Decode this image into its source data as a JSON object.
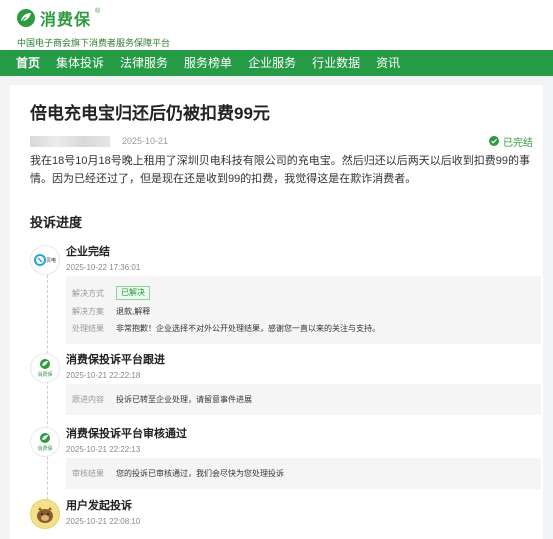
{
  "header": {
    "logo_text": "消费保",
    "logo_reg": "®",
    "tagline": "中国电子商会旗下消费者服务保障平台"
  },
  "nav": {
    "items": [
      "首页",
      "集体投诉",
      "法律服务",
      "服务榜单",
      "企业服务",
      "行业数据",
      "资讯"
    ]
  },
  "complaint": {
    "title": "倍电充电宝归还后仍被扣费99元",
    "date": "2025-10-21",
    "status": "已完结",
    "description": "我在18号10月18号晚上租用了深圳贝电科技有限公司的充电宝。然后归还以后两天以后收到扣费99的事情。因为已经还过了，但是现在还是收到99的扣费，我觉得这是在欺诈消费者。"
  },
  "progress": {
    "title": "投诉进度",
    "events": [
      {
        "avatar_label": "贝电",
        "title": "企业完结",
        "time": "2025-10-22 17:36:01",
        "details": [
          {
            "k": "解决方式",
            "v": "已解决"
          },
          {
            "k": "解决方案",
            "v": "退款,解释"
          },
          {
            "k": "处理结果",
            "v": "非常抱歉！企业选择不对外公开处理结果，感谢您一直以来的关注与支持。"
          }
        ]
      },
      {
        "avatar_label": "消费保",
        "title": "消费保投诉平台跟进",
        "time": "2025-10-21 22:22:18",
        "details": [
          {
            "k": "跟进内容",
            "v": "投诉已转至企业处理，请留意事件进展"
          }
        ]
      },
      {
        "avatar_label": "消费保",
        "title": "消费保投诉平台审核通过",
        "time": "2025-10-21 22:22:13",
        "details": [
          {
            "k": "审核结果",
            "v": "您的投诉已审核通过，我们会尽快为您处理投诉"
          }
        ]
      },
      {
        "avatar_label": "",
        "title": "用户发起投诉",
        "time": "2025-10-21 22:08:10",
        "details": []
      }
    ]
  },
  "colors": {
    "brand": "#259b45",
    "status": "#2e9a3f"
  },
  "icons": [
    "leaf-logo-icon",
    "check-circle-icon",
    "beidian-logo-icon",
    "xiaofeibao-logo-icon",
    "user-avatar-icon"
  ]
}
